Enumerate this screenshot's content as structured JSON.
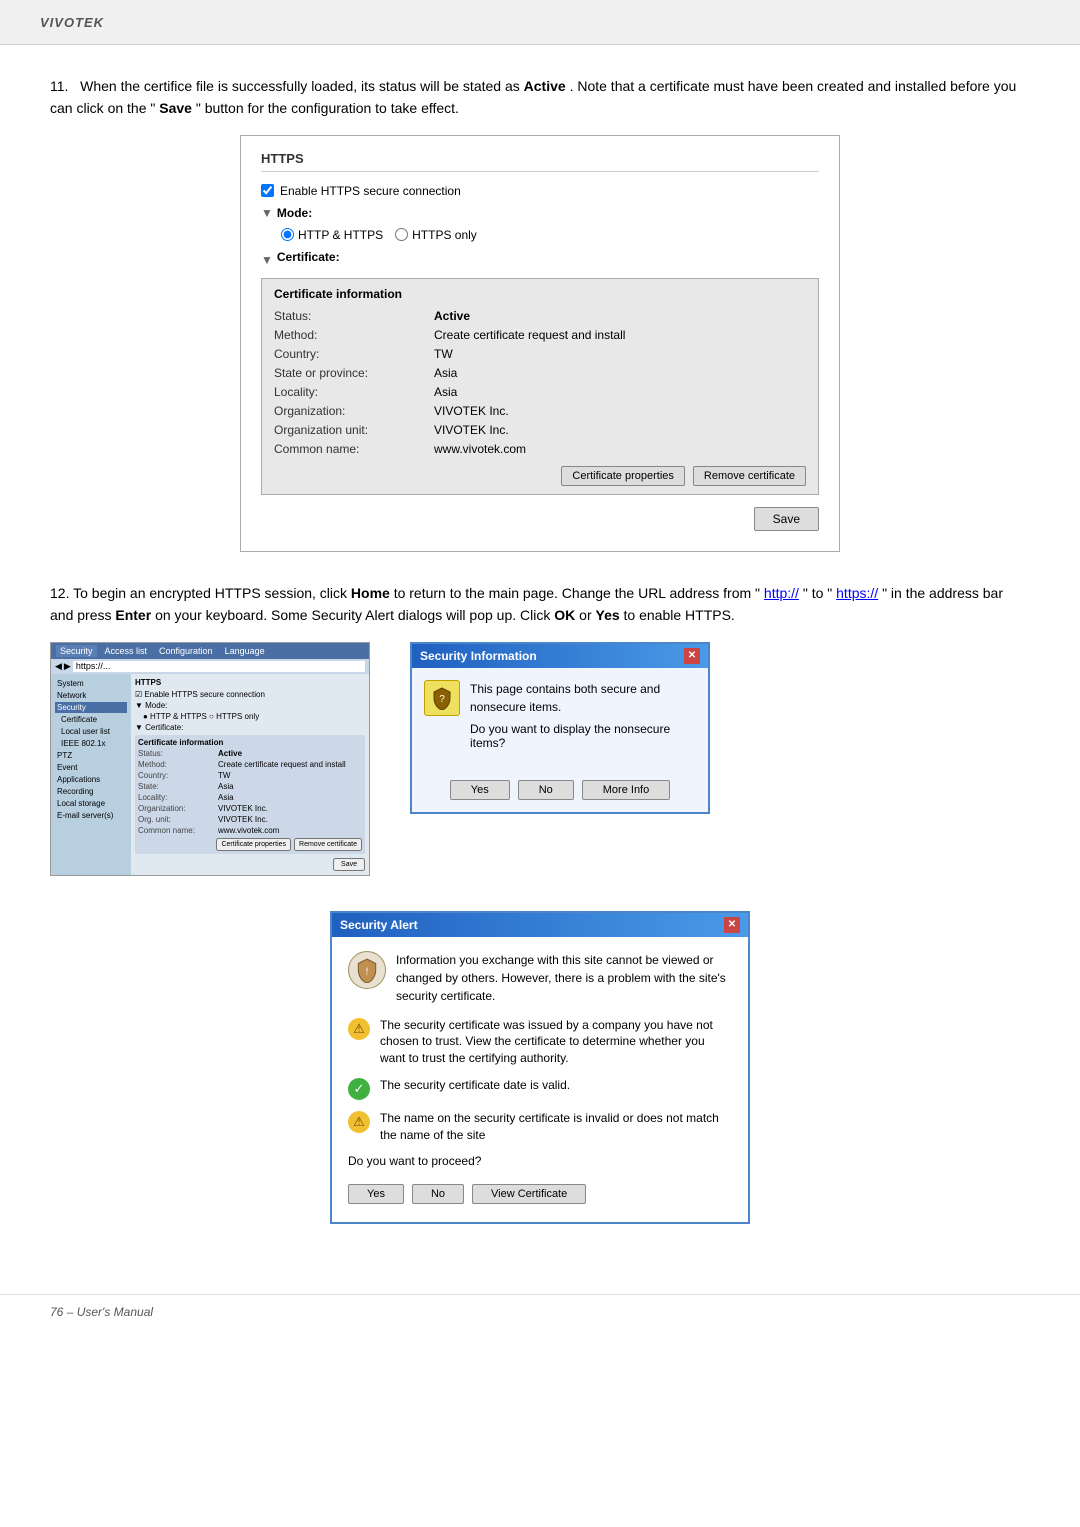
{
  "brand": "VIVOTEK",
  "section11": {
    "number": "11.",
    "text": "When the certifice file is successfully loaded, its status will be stated as",
    "highlight1": "Active",
    "text2": ". Note that a certificate must have been created and installed before you can click on the \"",
    "highlight2": "Save",
    "text3": "\" button for the configuration to take effect."
  },
  "httpsBox": {
    "title": "HTTPS",
    "enableLabel": "Enable HTTPS secure connection",
    "modeLabel": "Mode:",
    "modeArrow": "▼",
    "radio1": "HTTP & HTTPS",
    "radio2": "HTTPS only",
    "certLabel": "Certificate:",
    "certArrow": "▼",
    "certInfoHeader": "Certificate information",
    "fields": [
      {
        "key": "Status:",
        "val": "Active",
        "active": true
      },
      {
        "key": "Method:",
        "val": "Create certificate request and install"
      },
      {
        "key": "Country:",
        "val": "TW"
      },
      {
        "key": "State or province:",
        "val": "Asia"
      },
      {
        "key": "Locality:",
        "val": "Asia"
      },
      {
        "key": "Organization:",
        "val": "VIVOTEK Inc."
      },
      {
        "key": "Organization unit:",
        "val": "VIVOTEK Inc."
      },
      {
        "key": "Common name:",
        "val": "www.vivotek.com"
      }
    ],
    "certPropBtn": "Certificate properties",
    "removeCertBtn": "Remove certificate",
    "saveBtn": "Save"
  },
  "section12": {
    "number": "12.",
    "text1": "To begin an encrypted HTTPS session, click",
    "homeLink": "Home",
    "text2": "to return to the main page. Change the URL address from \"",
    "url1": "http://",
    "text3": "\" to \"",
    "url2": "https://",
    "text4": "\" in the address bar and press",
    "enterKey": "Enter",
    "text5": "on your keyboard. Some Security Alert dialogs will pop up. Click",
    "okKey": "OK",
    "text6": "or",
    "yesKey": "Yes",
    "text7": "to enable HTTPS."
  },
  "browserScreenshot": {
    "titlebarTabs": [
      "Security",
      "Access list",
      "Configuration",
      "Language"
    ],
    "sidebar": {
      "items": [
        "System",
        "Network",
        "Security",
        "PTZ",
        "Event",
        "Applications",
        "Recording",
        "Local storage",
        "E-mail server(s)"
      ]
    },
    "subItems": [
      "Certificate",
      "Local user list",
      "IEEE 802.1x"
    ]
  },
  "securityInfoDialog": {
    "title": "Security Information",
    "text1": "This page contains both secure and nonsecure items.",
    "text2": "Do you want to display the nonsecure items?",
    "yesBtn": "Yes",
    "noBtn": "No",
    "moreInfoBtn": "More Info"
  },
  "securityAlertDialog": {
    "title": "Security Alert",
    "mainText": "Information you exchange with this site cannot be viewed or changed by others. However, there is a problem with the site's security certificate.",
    "items": [
      {
        "type": "warning",
        "text": "The security certificate was issued by a company you have not chosen to trust. View the certificate to determine whether you want to trust the certifying authority."
      },
      {
        "type": "ok",
        "text": "The security certificate date is valid."
      },
      {
        "type": "warning",
        "text": "The name on the security certificate is invalid or does not match the name of the site"
      }
    ],
    "question": "Do you want to proceed?",
    "yesBtn": "Yes",
    "noBtn": "No",
    "viewCertBtn": "View Certificate"
  },
  "footer": {
    "pageNum": "76",
    "label": "– User's Manual"
  }
}
